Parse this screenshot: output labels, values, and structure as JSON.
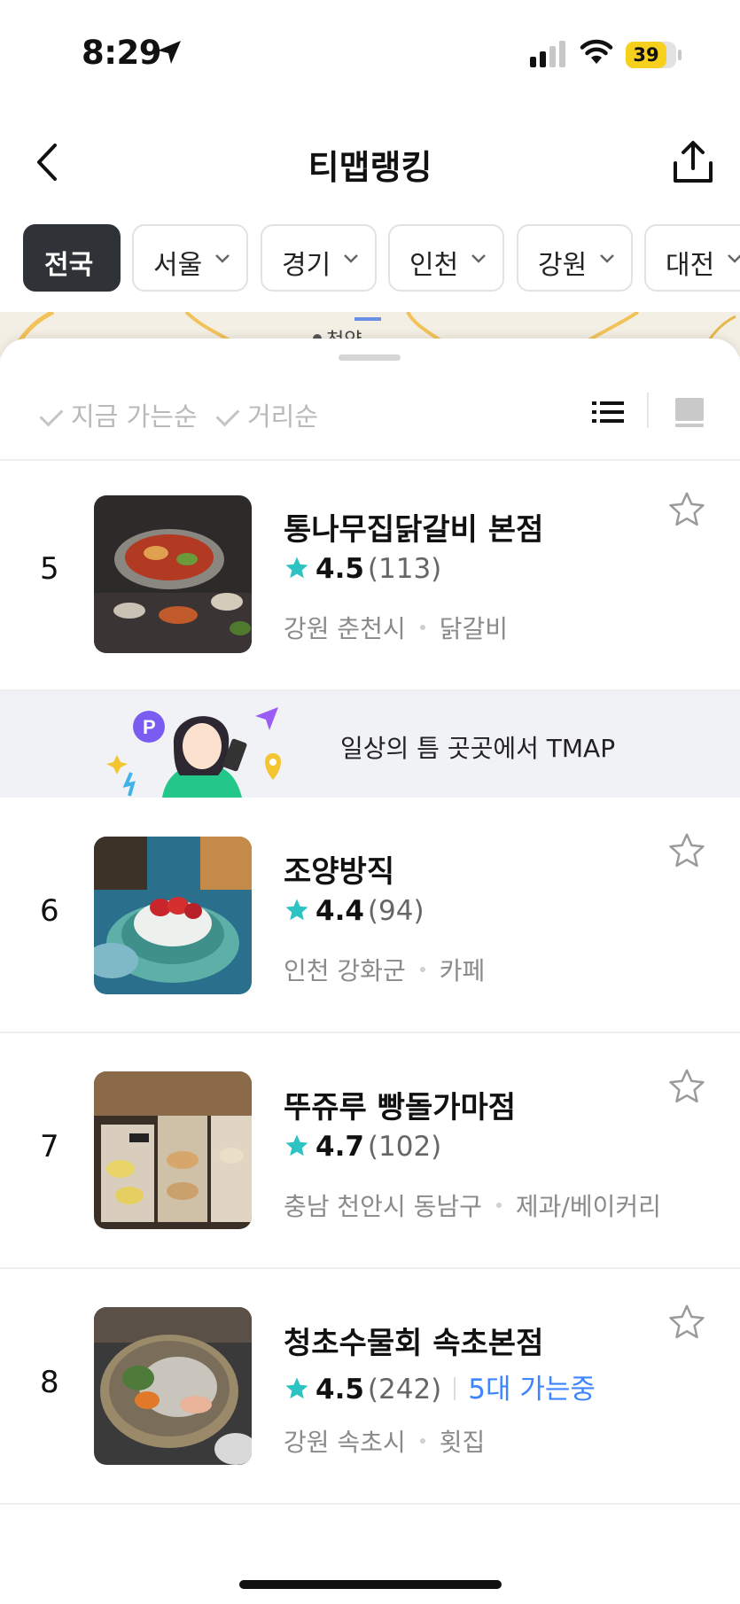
{
  "status_bar": {
    "time": "8:29",
    "battery": "39",
    "icons": [
      "location-arrow-icon",
      "signal-icon",
      "wifi-icon",
      "battery-icon"
    ]
  },
  "header": {
    "title": "티맵랭킹",
    "back_icon": "chevron-left-icon",
    "share_icon": "share-icon"
  },
  "regions": [
    {
      "label": "전국",
      "selected": true
    },
    {
      "label": "서울",
      "selected": false
    },
    {
      "label": "경기",
      "selected": false
    },
    {
      "label": "인천",
      "selected": false
    },
    {
      "label": "강원",
      "selected": false
    },
    {
      "label": "대전",
      "selected": false
    }
  ],
  "map": {
    "label": "청양"
  },
  "sort": {
    "options": [
      "지금 가는순",
      "거리순"
    ],
    "view_icons": [
      "list-view-icon",
      "card-view-icon"
    ]
  },
  "items": [
    {
      "rank": "5",
      "name": "통나무집닭갈비 본점",
      "rating": "4.5",
      "reviews": "(113)",
      "availability": "",
      "region": "강원 춘천시",
      "category": "닭갈비"
    },
    {
      "rank": "6",
      "name": "조양방직",
      "rating": "4.4",
      "reviews": "(94)",
      "availability": "",
      "region": "인천 강화군",
      "category": "카페"
    },
    {
      "rank": "7",
      "name": "뚜쥬루 빵돌가마점",
      "rating": "4.7",
      "reviews": "(102)",
      "availability": "",
      "region": "충남 천안시 동남구",
      "category": "제과/베이커리"
    },
    {
      "rank": "8",
      "name": "청초수물회 속초본점",
      "rating": "4.5",
      "reviews": "(242)",
      "availability": "5대 가는중",
      "region": "강원 속초시",
      "category": "횟집"
    }
  ],
  "banner": {
    "text": "일상의 틈 곳곳에서 TMAP"
  },
  "colors": {
    "accent_star": "#2cc3c2",
    "availability_blue": "#3d84ff",
    "active_chip": "#2f3236",
    "battery": "#f7cf1d"
  }
}
